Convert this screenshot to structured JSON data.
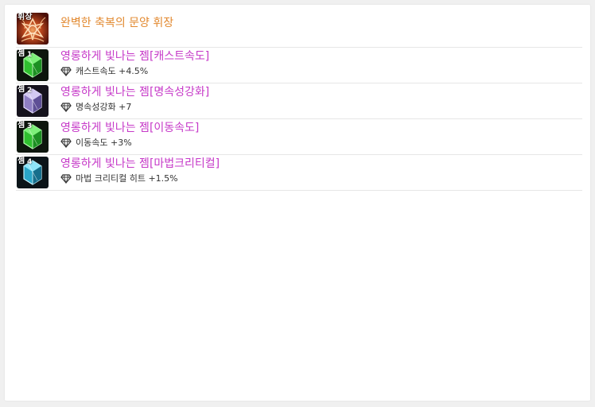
{
  "emblem": {
    "icon": "emblem-icon",
    "tag": "휘장",
    "name": "완벽한 축복의 문양 휘장",
    "color": "#e2882e"
  },
  "gems": [
    {
      "icon": "gem-green-icon",
      "tag": "젬",
      "slot": "1",
      "name": "영롱하게 빛나는 젬[캐스트속도]",
      "stat_icon": "diamond-icon",
      "stat": "캐스트속도 +4.5%",
      "color": "#c639c8"
    },
    {
      "icon": "gem-purple-icon",
      "tag": "젬",
      "slot": "2",
      "name": "영롱하게 빛나는 젬[명속성강화]",
      "stat_icon": "diamond-icon",
      "stat": "명속성강화 +7",
      "color": "#c639c8"
    },
    {
      "icon": "gem-green-icon",
      "tag": "젬",
      "slot": "3",
      "name": "영롱하게 빛나는 젬[이동속도]",
      "stat_icon": "diamond-icon",
      "stat": "이동속도 +3%",
      "color": "#c639c8"
    },
    {
      "icon": "gem-cyan-icon",
      "tag": "젬",
      "slot": "4",
      "name": "영롱하게 빛나는 젬[마법크리티컬]",
      "stat_icon": "diamond-icon",
      "stat": "마법 크리티컬 히트 +1.5%",
      "color": "#c639c8"
    }
  ]
}
